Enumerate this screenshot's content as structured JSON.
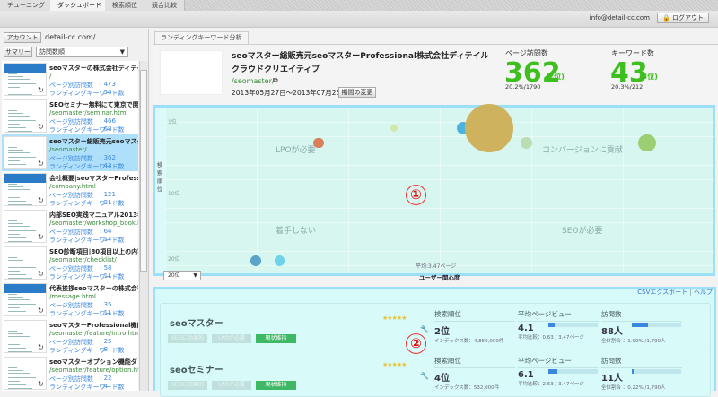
{
  "tabs": [
    "チューニング",
    "ダッシュボード",
    "検索順位",
    "競合比較"
  ],
  "active_tab": 1,
  "user": {
    "email": "info@detail-cc.com",
    "logout": "🔒 ログアウト"
  },
  "sidebar": {
    "account_button": "アカウント",
    "domain": "detail-cc.com/",
    "summary_button": "サマリー",
    "sort_select": "訪問数順",
    "pv_label": "ページ別訪問数",
    "kw_label": "ランディングキーワード数",
    "items": [
      {
        "title": "seoマスターの株式会社ディテイル",
        "url": "/",
        "pv": ": 473",
        "kw": ": 50"
      },
      {
        "title": "SEOセミナー無料にて東京で開催",
        "url": "/seomaster/seminar.html",
        "pv": ": 466",
        "kw": ": 68"
      },
      {
        "title": "seoマスター総販売元seoマスター",
        "url": "/seomaster/",
        "pv": ": 362",
        "kw": ": 43",
        "selected": true
      },
      {
        "title": "会社概要|seoマスターProfessional",
        "url": "/company.html",
        "pv": ": 121",
        "kw": ": 21"
      },
      {
        "title": "内部SEO実践マニュアル2013年",
        "url": "/seomaster/workshop_book.html",
        "pv": ": 64",
        "kw": ": 17"
      },
      {
        "title": "SEO診断項目|80項目以上の内容",
        "url": "/seomaster/checklist/",
        "pv": ": 58",
        "kw": ": 11"
      },
      {
        "title": "代表挨拶seoマスターの株式会社",
        "url": "/message.html",
        "pv": ": 35",
        "kw": ": 11"
      },
      {
        "title": "seoマスターProfessional機能と",
        "url": "/seomaster/feature/intro.html",
        "pv": ": 25",
        "kw": ": 8"
      },
      {
        "title": "seoマスターオプション機能ダッシュ",
        "url": "/seomaster/feature/option.html",
        "pv": ": 22",
        "kw": ": 4"
      }
    ]
  },
  "main": {
    "tab": "ランディングキーワード分析",
    "page_title": "seoマスター総販売元seoマスターProfessional株式会社ディテイルクラウドクリエイティブ",
    "page_url": "/seomaster/",
    "link_icon": "⧉",
    "date_range": "2013年05月27日～2013年07月25日",
    "change_period": "期間の変更",
    "page_visits": {
      "label": "ページ訪問数",
      "value": "362",
      "rank": "(2位)",
      "ratio": "20.2%/1790"
    },
    "keywords": {
      "label": "キーワード数",
      "value": "43",
      "rank": "(3位)",
      "ratio": "20.3%/212"
    }
  },
  "chart_data": {
    "type": "scatter",
    "ylabel": "検索順位",
    "xlabel": "ユーザー関心度",
    "yticks": [
      "1位",
      "10位",
      "20位"
    ],
    "ylim": [
      1,
      20
    ],
    "xlim": [
      0,
      6.94
    ],
    "average_label": "平均:3.47ページ",
    "average_x": 3.47,
    "quadrants": [
      "LPOが必要",
      "コンバージョンに貢献",
      "着手しない",
      "SEOが必要"
    ],
    "points": [
      {
        "x": 1.94,
        "y": 4,
        "visits": 4,
        "color": "#d9805a"
      },
      {
        "x": 2.9,
        "y": 2,
        "visits": 2,
        "color": "#cfeaa8"
      },
      {
        "x": 3.77,
        "y": 2,
        "visits": 6,
        "color": "#4ab4e0"
      },
      {
        "x": 4.1,
        "y": 2,
        "visits": 88,
        "color": "#cfb25e"
      },
      {
        "x": 4.57,
        "y": 4,
        "visits": 5,
        "color": "#bcdcb4"
      },
      {
        "x": 6.1,
        "y": 4,
        "visits": 11,
        "color": "#9ccf74"
      },
      {
        "x": 1.15,
        "y": 20,
        "visits": 4,
        "color": "#5aa4c8"
      },
      {
        "x": 1.45,
        "y": 20,
        "visits": 4,
        "color": "#6fd2e8"
      }
    ],
    "rank_filter": "20位"
  },
  "markers": [
    "①",
    "②"
  ],
  "list": {
    "csv": "CSVエクスポート",
    "sep": "|",
    "help": "ヘルプ",
    "tags": [
      "SEOに効果的",
      "LPOが必要",
      "現状維持"
    ],
    "stars": "★★★★★",
    "labels": {
      "rank": "検索順位",
      "pv": "平均ページビュー",
      "visits": "訪問数"
    },
    "keywords": [
      {
        "name": "seoマスター",
        "rank": "2位",
        "index": "インデックス数：4,850,000件",
        "pv": "4.1",
        "pv_sub": "平均比較：0.63 / 3.47ページ",
        "pv_frac": 0.12,
        "visits": "88人",
        "visits_sub": "全体割合 ：1.90% /1,790人",
        "visits_frac": 0.33
      },
      {
        "name": "seoセミナー",
        "rank": "4位",
        "index": "インデックス数：532,000件",
        "pv": "6.1",
        "pv_sub": "平均比較：2.63 / 3.47ページ",
        "pv_frac": 0.18,
        "visits": "11人",
        "visits_sub": "全体割合 ：0.22% /1,790人",
        "visits_frac": 0.04
      }
    ]
  }
}
